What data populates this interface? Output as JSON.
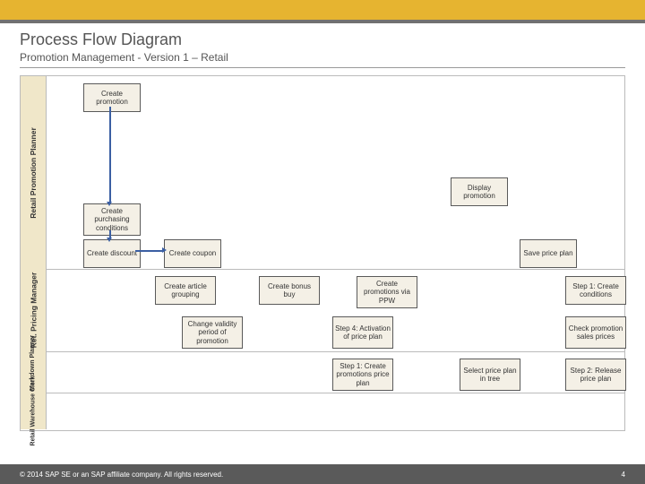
{
  "title": "Process Flow Diagram",
  "subtitle": "Promotion Management - Version 1 – Retail",
  "lanes": {
    "l0": "Retail Promotion Planner",
    "l1": "Ret. Pricing Manager",
    "l2": "Retail Markdown Planner",
    "l3": "Retail Warehouse Clerk"
  },
  "boxes": {
    "b1": "Create promotion",
    "b2": "Display promotion",
    "b3": "Create purchasing conditions",
    "b4": "Create discount",
    "b5": "Create coupon",
    "b6": "Save price plan",
    "b7": "Create article grouping",
    "b8": "Create bonus buy",
    "b9": "Create promotions via PPW",
    "b10": "Step 1: Create conditions",
    "b11": "Change validity period of promotion",
    "b12": "Step 4: Activation of price plan",
    "b13": "Check promotion sales prices",
    "b14": "Step 1: Create promotions price plan",
    "b15": "Select price plan in tree",
    "b16": "Step 2: Release price plan"
  },
  "footer": {
    "left": "© 2014 SAP SE or an SAP affiliate company. All rights reserved.",
    "right": "4"
  }
}
